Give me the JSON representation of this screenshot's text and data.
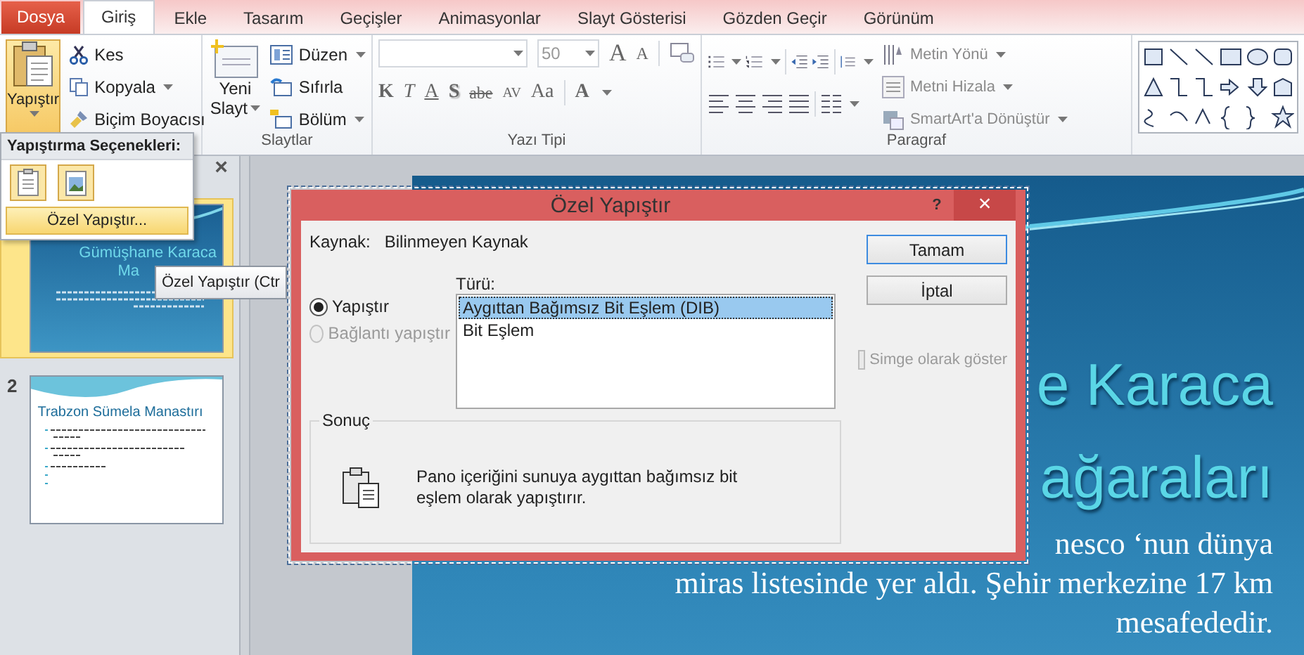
{
  "tabs": [
    {
      "label": "Dosya",
      "kind": "file",
      "selected": false
    },
    {
      "label": "Giriş",
      "kind": "tab",
      "selected": true
    },
    {
      "label": "Ekle",
      "kind": "tab",
      "selected": false
    },
    {
      "label": "Tasarım",
      "kind": "tab",
      "selected": false
    },
    {
      "label": "Geçişler",
      "kind": "tab",
      "selected": false
    },
    {
      "label": "Animasyonlar",
      "kind": "tab",
      "selected": false
    },
    {
      "label": "Slayt Gösterisi",
      "kind": "tab",
      "selected": false
    },
    {
      "label": "Gözden Geçir",
      "kind": "tab",
      "selected": false
    },
    {
      "label": "Görünüm",
      "kind": "tab",
      "selected": false
    }
  ],
  "clipboard": {
    "paste": {
      "label": "Yapıştır",
      "expanded": true
    },
    "commands": [
      {
        "label": "Kes",
        "kind": "cut",
        "dropdown": false
      },
      {
        "label": "Kopyala",
        "kind": "copy",
        "dropdown": true
      },
      {
        "label": "Biçim Boyacısı",
        "kind": "brush",
        "dropdown": false
      }
    ]
  },
  "slides_group": {
    "new_slide": [
      "Yeni",
      "Slayt"
    ],
    "commands": [
      {
        "label": "Düzen",
        "kind": "layout",
        "dropdown": true
      },
      {
        "label": "Sıfırla",
        "kind": "reset",
        "dropdown": false
      },
      {
        "label": "Bölüm",
        "kind": "section",
        "dropdown": true
      }
    ],
    "label": "Slaytlar"
  },
  "font_group": {
    "font_size": "50",
    "size_buttons": [
      "A",
      "A"
    ],
    "format_buttons": [
      "K",
      "T",
      "A",
      "S",
      "abe",
      "AV",
      "Aa"
    ],
    "color_button": "A",
    "label": "Yazı Tipi"
  },
  "paragraph_group": {
    "commands": [
      {
        "label": "Metin Yönü",
        "kind": "direction",
        "disabled": true
      },
      {
        "label": "Metni Hizala",
        "kind": "align",
        "disabled": true
      },
      {
        "label": "SmartArt'a Dönüştür",
        "kind": "smartart",
        "disabled": true
      }
    ],
    "label": "Paragraf"
  },
  "paste_menu": {
    "title": "Yapıştırma Seçenekleri:",
    "options": [
      {
        "kind": "keep"
      },
      {
        "kind": "picture"
      }
    ],
    "special": "Özel Yapıştır..."
  },
  "tooltip": "Özel Yapıştır (Ctr",
  "slide_panel": {
    "close": "×",
    "slides": [
      {
        "kind": "title",
        "selected": true,
        "title_lines": [
          "Gümüşhane Karaca",
          "Ma"
        ]
      },
      {
        "kind": "content",
        "number": "2",
        "selected": false,
        "title": "Trabzon Sümela Manastırı"
      }
    ]
  },
  "slide": {
    "title_lines": [
      "e Karaca",
      "ağaraları"
    ],
    "body_lines": [
      "nesco ‘nun dünya",
      "miras listesinde yer aldı. Şehir merkezine 17 km",
      "mesafededir."
    ]
  },
  "dialog": {
    "title": "Özel Yapıştır",
    "help": "?",
    "close": "×",
    "source_label": "Kaynak:",
    "source": "Bilinmeyen Kaynak",
    "options": [
      {
        "label": "Yapıştır",
        "selected": true,
        "disabled": false
      },
      {
        "label": "Bağlantı yapıştır",
        "selected": false,
        "disabled": true
      }
    ],
    "type_label": "Türü:",
    "types": [
      {
        "label": "Aygıttan Bağımsız Bit Eşlem (DIB)",
        "selected": true
      },
      {
        "label": "Bit Eşlem",
        "selected": false
      }
    ],
    "buttons": [
      "Tamam",
      "İptal"
    ],
    "icon_checkbox": {
      "label": "Simge olarak göster",
      "checked": false,
      "disabled": true
    },
    "result": {
      "label": "Sonuç",
      "text": "Pano içeriğini sunuya aygıttan bağımsız bit eşlem olarak yapıştırır."
    }
  }
}
